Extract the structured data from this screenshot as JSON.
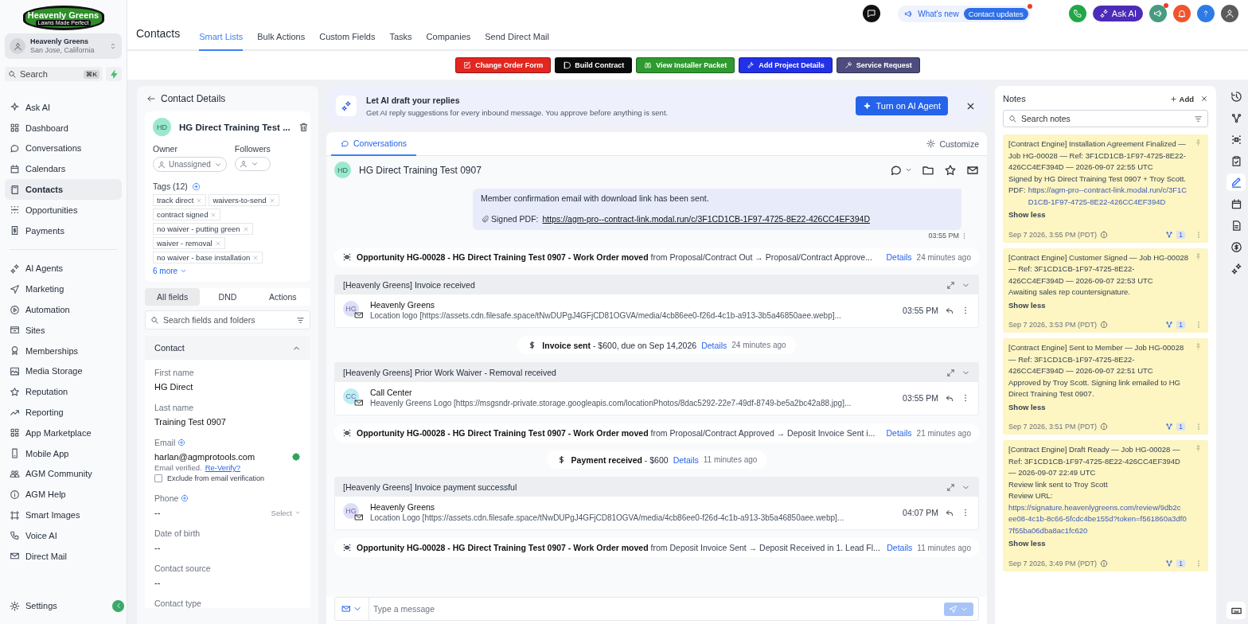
{
  "logo": {
    "name": "Heavenly Greens",
    "tagline": "Lawns Made Perfect"
  },
  "account": {
    "name": "Heavenly Greens",
    "location": "San Jose, California"
  },
  "sidebar_search": {
    "placeholder": "Search",
    "shortcut": "⌘K"
  },
  "nav_groups": [
    [
      {
        "label": "Ask AI",
        "selected": false
      },
      {
        "label": "Dashboard",
        "selected": false
      },
      {
        "label": "Conversations",
        "selected": false
      },
      {
        "label": "Calendars",
        "selected": false
      },
      {
        "label": "Contacts",
        "selected": true
      },
      {
        "label": "Opportunities",
        "selected": false
      },
      {
        "label": "Payments",
        "selected": false
      }
    ],
    [
      {
        "label": "AI Agents",
        "selected": false
      },
      {
        "label": "Marketing",
        "selected": false
      },
      {
        "label": "Automation",
        "selected": false
      },
      {
        "label": "Sites",
        "selected": false
      },
      {
        "label": "Memberships",
        "selected": false
      },
      {
        "label": "Media Storage",
        "selected": false
      },
      {
        "label": "Reputation",
        "selected": false
      },
      {
        "label": "Reporting",
        "selected": false
      },
      {
        "label": "App Marketplace",
        "selected": false
      },
      {
        "label": "Mobile App",
        "selected": false
      },
      {
        "label": "AGM Community",
        "selected": false
      },
      {
        "label": "AGM Help",
        "selected": false
      },
      {
        "label": "Smart Images",
        "selected": false
      },
      {
        "label": "Voice AI",
        "selected": false
      },
      {
        "label": "Direct Mail",
        "selected": false
      }
    ]
  ],
  "settings": {
    "label": "Settings",
    "selected": false
  },
  "header": {
    "title": "Contacts",
    "tabs": [
      {
        "label": "Smart Lists",
        "selected": true
      },
      {
        "label": "Bulk Actions",
        "selected": false
      },
      {
        "label": "Custom Fields",
        "selected": false
      },
      {
        "label": "Tasks",
        "selected": false
      },
      {
        "label": "Companies",
        "selected": false
      },
      {
        "label": "Send Direct Mail",
        "selected": false
      }
    ],
    "whats_new": {
      "label": "What's new",
      "badge": "Contact updates",
      "notification": true
    },
    "ask_ai": "Ask AI",
    "announcements": {
      "notification": true
    }
  },
  "action_buttons": [
    {
      "label": "Change Order Form",
      "color": "#e3261f"
    },
    {
      "label": "Build Contract",
      "color": "#0b0b0b"
    },
    {
      "label": "View Installer Packet",
      "color": "#2f9a2f"
    },
    {
      "label": "Add Project Details",
      "color": "#2231e6"
    },
    {
      "label": "Service Request",
      "color": "#4d4c7d"
    }
  ],
  "contact": {
    "back_title": "Contact Details",
    "initials": "HD",
    "name": "HG Direct Training Test ...",
    "owner_label": "Owner",
    "owner_value": "Unassigned",
    "followers_label": "Followers",
    "tags_label": "Tags (12)",
    "tags": [
      "track direct",
      "waivers-to-send",
      "contract signed",
      "no waiver - putting green",
      "waiver - removal",
      "no waiver - base installation"
    ],
    "more": "6 more",
    "tabs": [
      {
        "label": "All fields",
        "selected": true
      },
      {
        "label": "DND",
        "selected": false
      },
      {
        "label": "Actions",
        "selected": false
      }
    ],
    "search_placeholder": "Search fields and folders",
    "section": {
      "title": "Contact",
      "expanded": true
    },
    "fields": [
      {
        "kind": "text",
        "label": "First name",
        "value": "HG Direct"
      },
      {
        "kind": "text",
        "label": "Last name",
        "value": "Training Test 0907"
      },
      {
        "kind": "email",
        "label": "Email",
        "value": "harlan@agmprotools.com",
        "verified": true,
        "status": "Email verified.",
        "action": "Re-Verify?",
        "exclude_label": "Exclude from email verification",
        "exclude_checked": false
      },
      {
        "kind": "phone",
        "label": "Phone",
        "value": "--",
        "select": "Select"
      },
      {
        "kind": "text",
        "label": "Date of birth",
        "value": "--"
      },
      {
        "kind": "text",
        "label": "Contact source",
        "value": "--"
      },
      {
        "kind": "label_only",
        "label": "Contact type"
      }
    ]
  },
  "ai_banner": {
    "title": "Let AI draft your replies",
    "text": "Get AI reply suggestions for every inbound message. You approve before anything is sent.",
    "button": "Turn on AI Agent"
  },
  "conversation": {
    "tabs": [
      {
        "label": "Conversations",
        "selected": true
      }
    ],
    "customize": "Customize",
    "initials": "HD",
    "name": "HG Direct Training Test 0907",
    "items": [
      {
        "kind": "bubble",
        "lines": [
          "Member confirmation email with download link has been sent."
        ],
        "attachment_label": "Signed PDF:",
        "link": "https://agm-pro--contract-link.modal.run/c/3F1CD1CB-1F97-4725-8E22-426CC4EF394D",
        "time": "03:55 PM"
      },
      {
        "kind": "activity",
        "text": "**Opportunity HG-00028 - HG Direct Training Test 0907 - Work Order moved** from Proposal/Contract Out → Proposal/Contract Approve...",
        "link": "Details",
        "ago": "24 minutes ago"
      },
      {
        "kind": "thread",
        "subject": "[Heavenly Greens] Invoice received",
        "initials": "HG",
        "color": "#dedff7",
        "sender": "Heavenly Greens",
        "snippet": "Location logo [https://assets.cdn.filesafe.space/tNwDUPgJ4GFjCD81OGVA/media/4cb86ee0-f26d-4c1b-a913-3b5a46850aee.webp]...",
        "time": "03:55 PM"
      },
      {
        "kind": "pill",
        "text": "**Invoice sent** - $600, due on Sep 14,2026",
        "link": "Details",
        "ago": "24 minutes ago"
      },
      {
        "kind": "thread",
        "subject": "[Heavenly Greens] Prior Work Waiver - Removal received",
        "initials": "CC",
        "color": "#b9eef5",
        "sender": "Call Center",
        "snippet": "Heavenly Greens Logo [https://msgsndr-private.storage.googleapis.com/locationPhotos/8dac5292-22e7-49df-8749-be5a2bc42a88.jpg]...",
        "time": "03:55 PM"
      },
      {
        "kind": "activity",
        "text": "**Opportunity HG-00028 - HG Direct Training Test 0907 - Work Order moved** from Proposal/Contract Approved → Deposit Invoice Sent i...",
        "link": "Details",
        "ago": "21 minutes ago"
      },
      {
        "kind": "pill",
        "text": "**Payment received** - $600",
        "link": "Details",
        "ago": "11 minutes ago"
      },
      {
        "kind": "thread",
        "subject": "[Heavenly Greens] Invoice payment successful",
        "initials": "HG",
        "color": "#dedff7",
        "sender": "Heavenly Greens",
        "snippet": "Location Logo [https://assets.cdn.filesafe.space/tNwDUPgJ4GFjCD81OGVA/media/4cb86ee0-f26d-4c1b-a913-3b5a46850aee.webp]...",
        "time": "04:07 PM"
      },
      {
        "kind": "activity",
        "text": "**Opportunity HG-00028 - HG Direct Training Test 0907 - Work Order moved** from Deposit Invoice Sent → Deposit Received in 1. Lead Fl...",
        "link": "Details",
        "ago": "11 minutes ago"
      }
    ],
    "composer": {
      "placeholder": "Type a message"
    }
  },
  "notes": {
    "title": "Notes",
    "add": "Add",
    "search_placeholder": "Search notes",
    "items": [
      {
        "lines": [
          "[Contract Engine] Installation Agreement Finalized — Job HG-00028 — Ref: 3F1CD1CB-1F97-4725-8E22-426CC4EF394D — 2026-09-07 22:55 UTC",
          "Signed by HG Direct Training Test 0907 + Troy Scott."
        ],
        "link_prefix": "PDF:",
        "link_lines": [
          "https://agm-pro--contract-link.modal.run/c/3F1CD1CB-1F97-4725-8E22-426CC4EF394D"
        ],
        "toggle": "Show less",
        "date": "Sep 7 2026, 3:55 PM (PDT)",
        "count": "1"
      },
      {
        "lines": [
          "[Contract Engine] Customer Signed — Job HG-00028 — Ref: 3F1CD1CB-1F97-4725-8E22-426CC4EF394D — 2026-09-07 22:53 UTC",
          "Awaiting sales rep countersignature."
        ],
        "toggle": "Show less",
        "date": "Sep 7 2026, 3:53 PM (PDT)",
        "count": "1"
      },
      {
        "lines": [
          "[Contract Engine] Sent to Member — Job HG-00028 — Ref: 3F1CD1CB-1F97-4725-8E22-426CC4EF394D — 2026-09-07 22:51 UTC",
          "Approved by Troy Scott. Signing link emailed to HG Direct Training Test 0907."
        ],
        "toggle": "Show less",
        "date": "Sep 7 2026, 3:51 PM (PDT)",
        "count": "1"
      },
      {
        "lines": [
          "[Contract Engine] Draft Ready — Job HG-00028 — Ref: 3F1CD1CB-1F97-4725-8E22-426CC4EF394D — 2026-09-07 22:49 UTC",
          "Review link sent to Troy Scott",
          "Review URL:"
        ],
        "link_lines": [
          "https://signature.heavenlygreens.com/review/9db2c",
          "ee08-4c1b-8c66-5fcdc4be155d?token=f561860a3df07f55ba06dba8ac1fc620"
        ],
        "toggle": "Show less",
        "date": "Sep 7 2026, 3:49 PM (PDT)",
        "count": "1"
      }
    ]
  },
  "rail": [
    {
      "selected": false
    },
    {
      "selected": false
    },
    {
      "selected": false
    },
    {
      "selected": false
    },
    {
      "selected": true
    },
    {
      "selected": false
    },
    {
      "selected": false
    },
    {
      "selected": false
    },
    {
      "selected": false
    }
  ]
}
